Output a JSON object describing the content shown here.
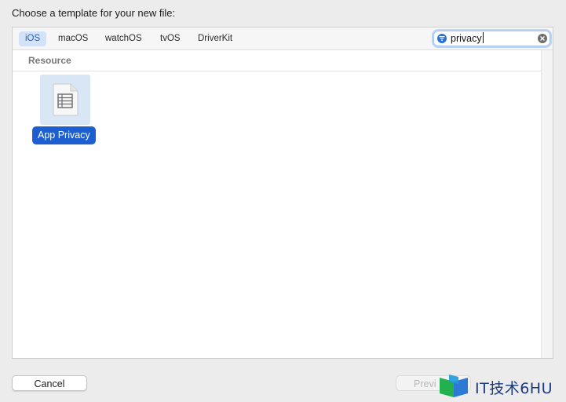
{
  "dialog": {
    "heading": "Choose a template for your new file:"
  },
  "platform_tabs": [
    {
      "label": "iOS",
      "selected": true
    },
    {
      "label": "macOS",
      "selected": false
    },
    {
      "label": "watchOS",
      "selected": false
    },
    {
      "label": "tvOS",
      "selected": false
    },
    {
      "label": "DriverKit",
      "selected": false
    }
  ],
  "search": {
    "value": "privacy",
    "icon": "filter-icon",
    "clear_icon": "clear-icon"
  },
  "sections": [
    {
      "title": "Resource",
      "templates": [
        {
          "label": "App Privacy",
          "icon": "document-table-icon",
          "selected": true
        }
      ]
    }
  ],
  "buttons": {
    "cancel": "Cancel",
    "previous": "Previ"
  },
  "watermark": {
    "text": "IT技术6HU"
  },
  "colors": {
    "accent": "#1d5fd1",
    "tab_selected_bg": "#d3e2f6",
    "tile_selected_bg": "#d9e6f6"
  }
}
